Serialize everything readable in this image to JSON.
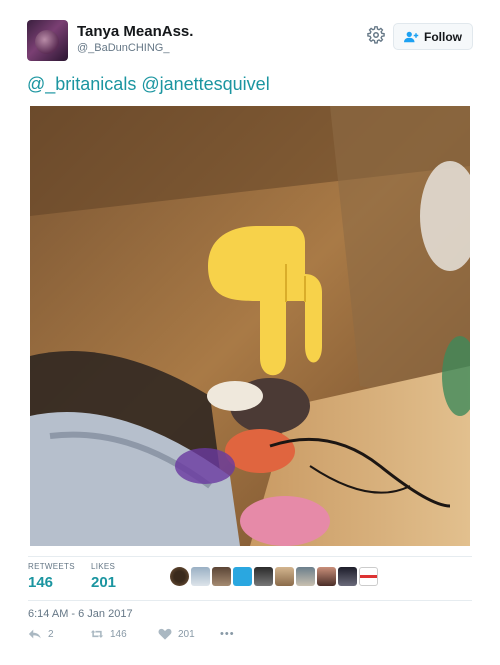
{
  "author": {
    "name": "Tanya MeanAss.",
    "handle": "@_BaDunCHING_"
  },
  "follow_label": "Follow",
  "tweet": {
    "mention1": "@_britanicals",
    "mention2": "@janettesquivel"
  },
  "stats": {
    "retweets_label": "RETWEETS",
    "retweets_count": "146",
    "likes_label": "LIKES",
    "likes_count": "201"
  },
  "timestamp": "6:14 AM - 6 Jan 2017",
  "actions": {
    "reply_count": "2",
    "retweet_count": "146",
    "like_count": "201",
    "more_label": "•••"
  },
  "icons": [
    "gear-icon",
    "follow-user-icon",
    "reply-icon",
    "retweet-icon",
    "heart-icon",
    "more-icon",
    "pointing-down-emoji"
  ],
  "colors": {
    "accent": "#1b95a0",
    "muted": "#657786",
    "emoji_yellow": "#f7d24a"
  }
}
